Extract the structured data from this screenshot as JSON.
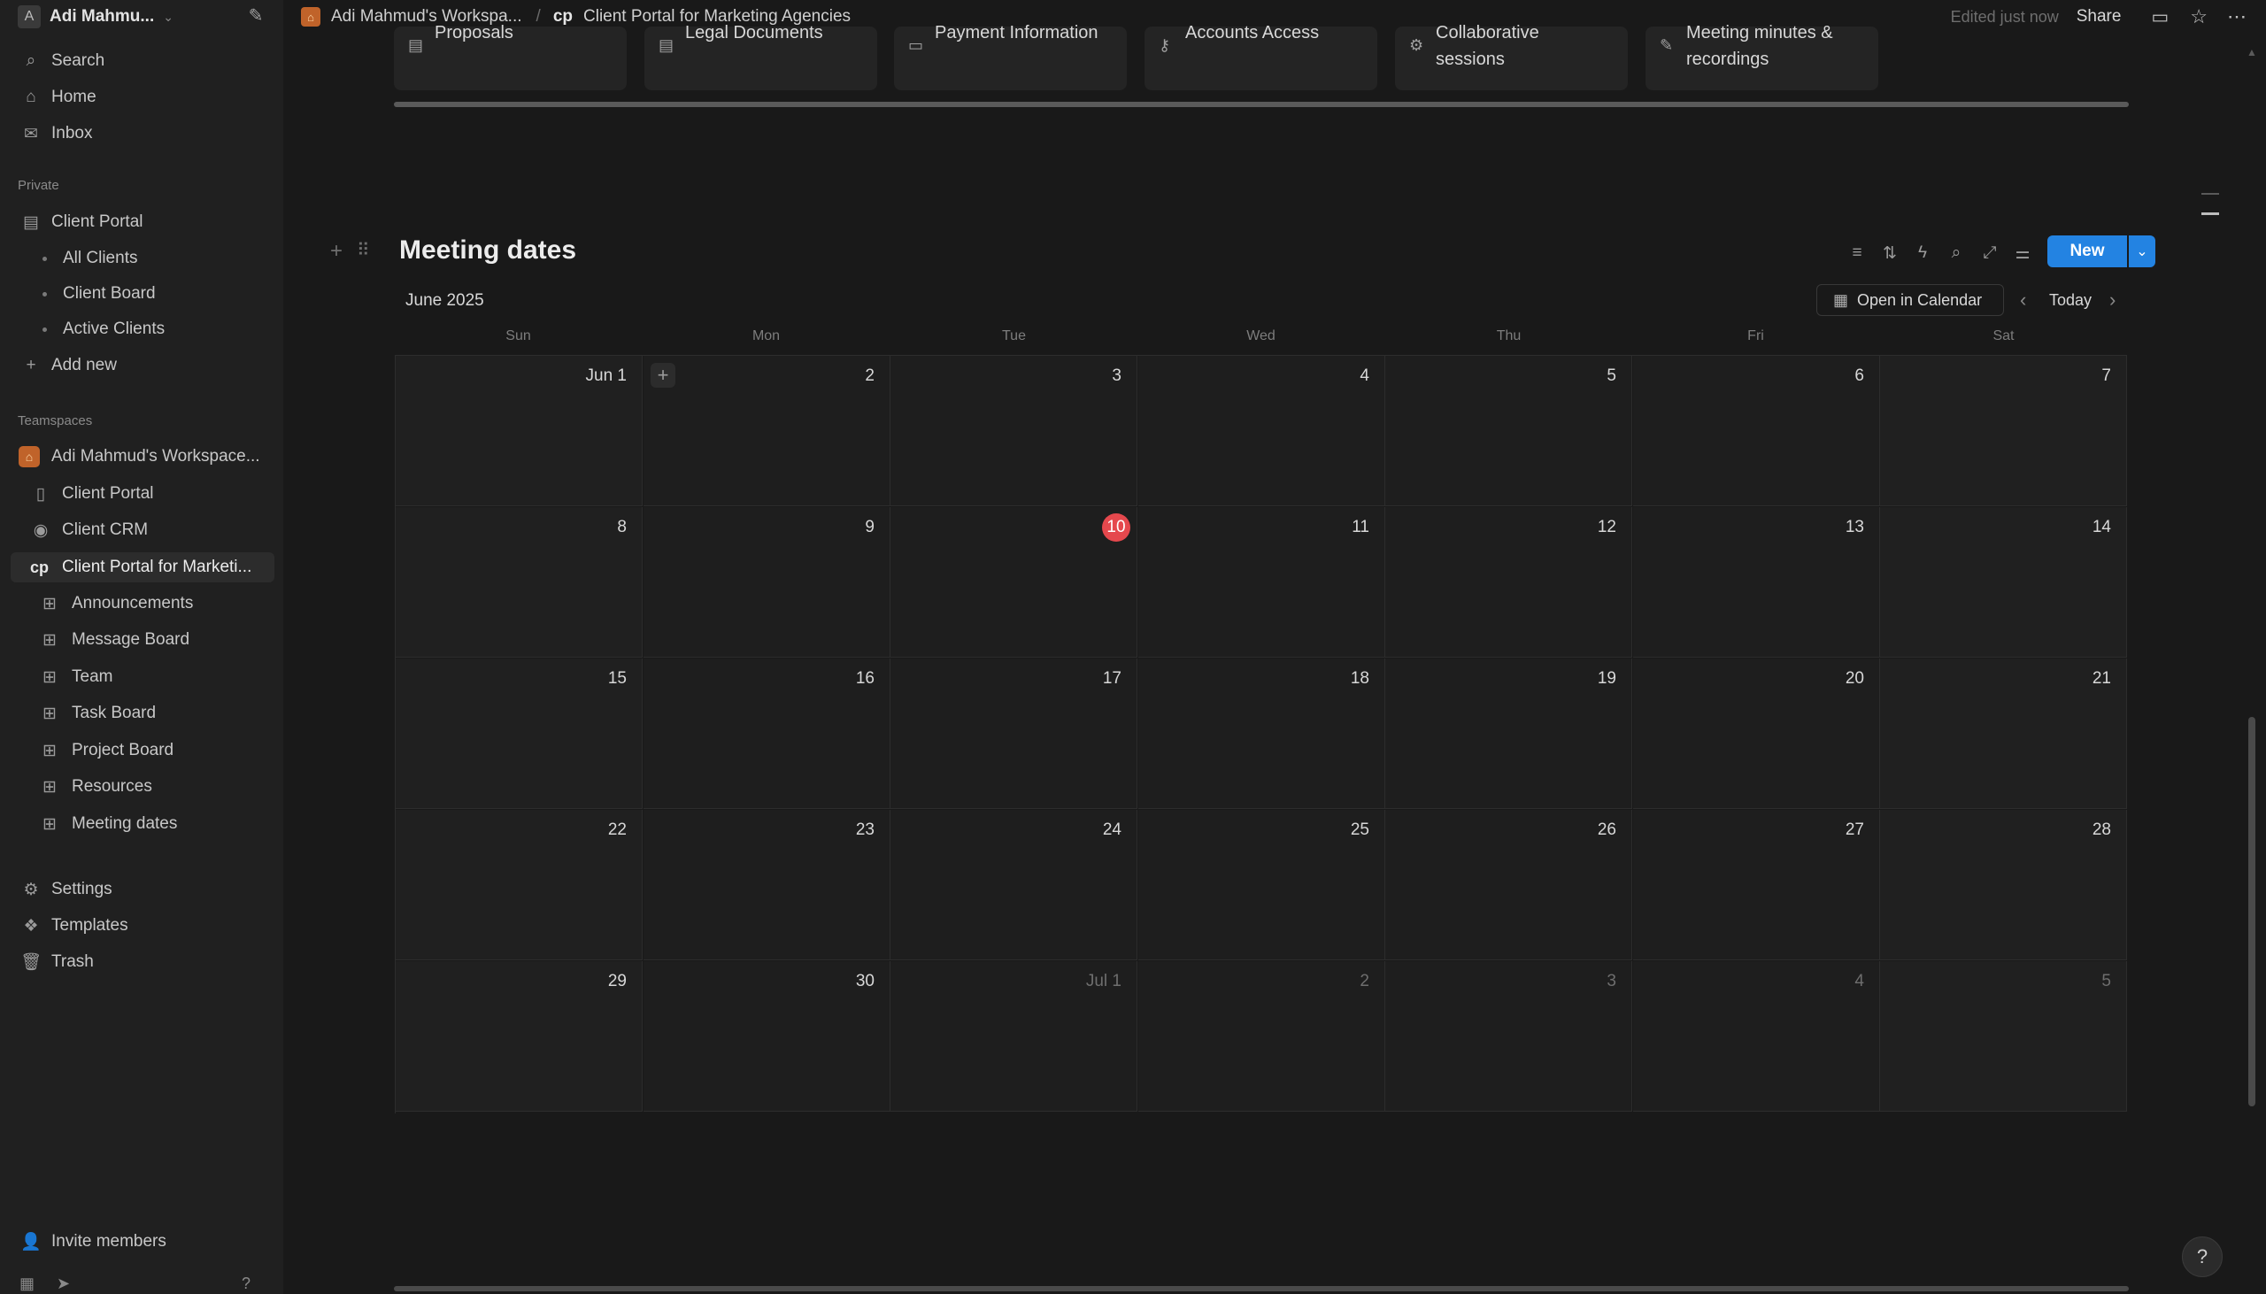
{
  "workspace": {
    "avatar_letter": "A",
    "name": "Adi Mahmu..."
  },
  "sidebar": {
    "top_items": [
      {
        "label": "Search"
      },
      {
        "label": "Home"
      },
      {
        "label": "Inbox"
      }
    ],
    "private_heading": "Private",
    "private_page": "Client Portal",
    "private_children": [
      "All Clients",
      "Client Board",
      "Active Clients"
    ],
    "add_new": "Add new",
    "teamspaces_heading": "Teamspaces",
    "teamspace_name": "Adi Mahmud's Workspace...",
    "team_pages": [
      "Client Portal",
      "Client CRM"
    ],
    "active_page_badge": "cp",
    "active_page": "Client Portal for Marketi...",
    "subpages": [
      "Announcements",
      "Message Board",
      "Team",
      "Task Board",
      "Project Board",
      "Resources",
      "Meeting dates"
    ],
    "bottom_items": [
      "Settings",
      "Templates",
      "Trash"
    ],
    "invite": "Invite members"
  },
  "topbar": {
    "crumb1": "Adi Mahmud's Workspa...",
    "crumb_sep": "/",
    "crumb2_badge": "cp",
    "crumb2": "Client Portal for Marketing Agencies",
    "edited": "Edited just now",
    "share": "Share"
  },
  "tiles": [
    {
      "label": "Proposals"
    },
    {
      "label": "Legal Documents"
    },
    {
      "label": "Payment Information"
    },
    {
      "label": "Accounts Access"
    },
    {
      "label": "Collaborative sessions"
    },
    {
      "label": "Meeting minutes & recordings"
    }
  ],
  "calendar": {
    "title": "Meeting dates",
    "month": "June 2025",
    "open_in_calendar": "Open in Calendar",
    "today": "Today",
    "new_button": "New",
    "weekdays": [
      "Sun",
      "Mon",
      "Tue",
      "Wed",
      "Thu",
      "Fri",
      "Sat"
    ],
    "weeks": [
      [
        "Jun 1",
        "2",
        "3",
        "4",
        "5",
        "6",
        "7"
      ],
      [
        "8",
        "9",
        "10",
        "11",
        "12",
        "13",
        "14"
      ],
      [
        "15",
        "16",
        "17",
        "18",
        "19",
        "20",
        "21"
      ],
      [
        "22",
        "23",
        "24",
        "25",
        "26",
        "27",
        "28"
      ],
      [
        "29",
        "30",
        "Jul 1",
        "2",
        "3",
        "4",
        "5"
      ]
    ],
    "today_date": "10",
    "accent_color": "#2383e2",
    "today_color": "#e5484d"
  }
}
